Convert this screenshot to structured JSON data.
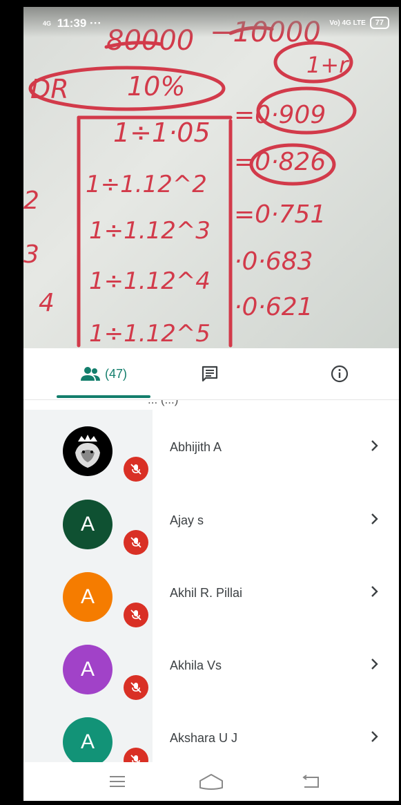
{
  "status_bar": {
    "network": "4G",
    "time": "11:39",
    "more": "···",
    "right_indicator": "Vo) 4G LTE",
    "battery": "77"
  },
  "tabs": {
    "people_count": "(47)",
    "people_icon": "people-icon",
    "chat_icon": "chat-icon",
    "info_icon": "info-icon"
  },
  "list": {
    "cutoff_text": "... (...)",
    "participants": [
      {
        "name": "Abhijith A",
        "avatar_letter": "",
        "avatar_color": "#000000"
      },
      {
        "name": "Ajay s",
        "avatar_letter": "A",
        "avatar_color": "#0f5132"
      },
      {
        "name": "Akhil R. Pillai",
        "avatar_letter": "A",
        "avatar_color": "#f57c00"
      },
      {
        "name": "Akhila Vs",
        "avatar_letter": "A",
        "avatar_color": "#a142c8"
      },
      {
        "name": "Akshara U J",
        "avatar_letter": "A",
        "avatar_color": "#129377"
      }
    ]
  },
  "navbar": {
    "menu_icon": "menu-icon",
    "home_icon": "home-icon",
    "back_icon": "back-icon"
  },
  "colors": {
    "accent": "#137e6c",
    "mic_off": "#d93025"
  }
}
